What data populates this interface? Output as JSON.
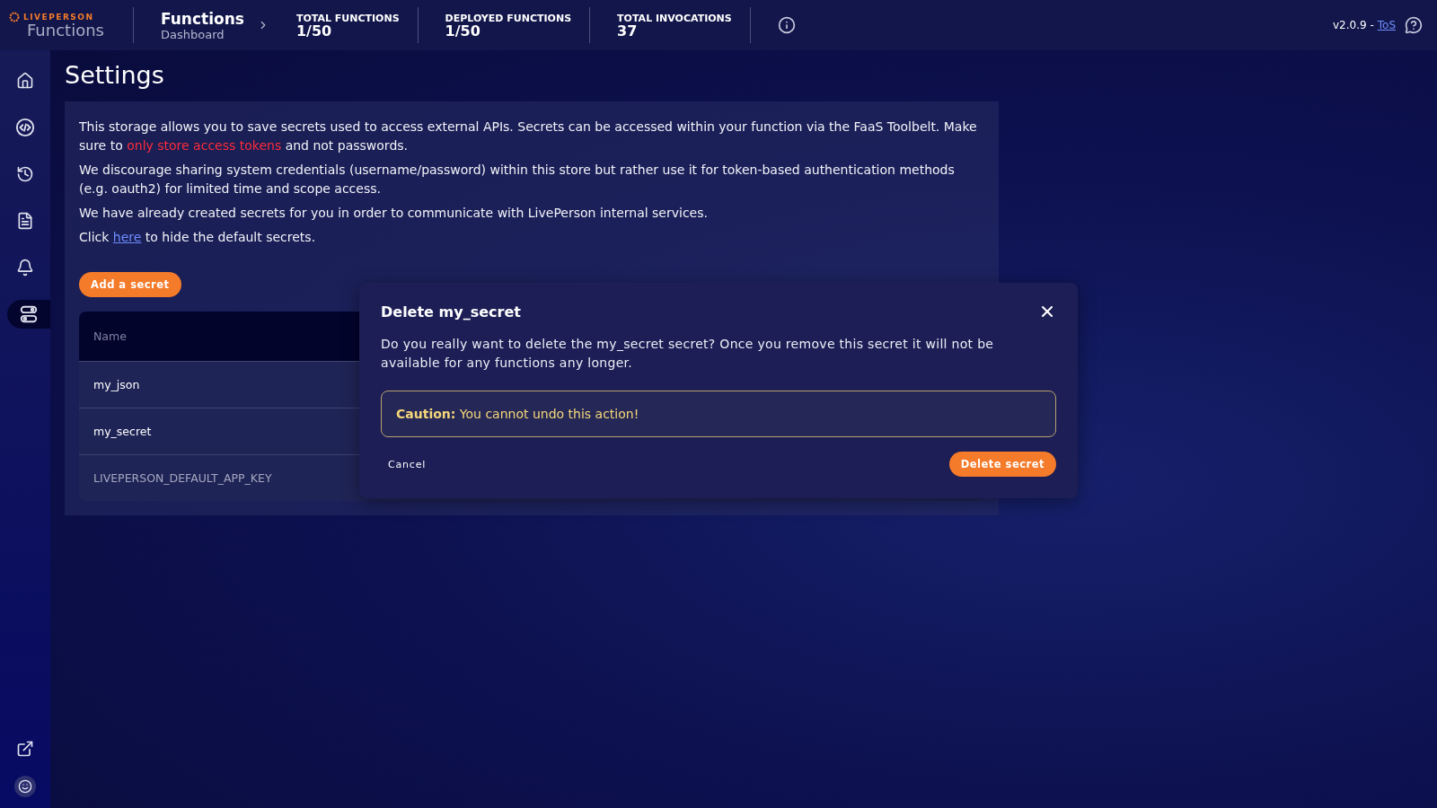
{
  "header": {
    "logo": {
      "brand": "LIVEPERSON",
      "product": "Functions"
    },
    "breadcrumb": {
      "title": "Functions",
      "subtitle": "Dashboard"
    },
    "stats": [
      {
        "label": "TOTAL FUNCTIONS",
        "value": "1/50"
      },
      {
        "label": "DEPLOYED FUNCTIONS",
        "value": "1/50"
      },
      {
        "label": "TOTAL INVOCATIONS",
        "value": "37"
      }
    ],
    "version": "v2.0.9 - ",
    "tos_link": "ToS"
  },
  "sidebar": {
    "items": [
      {
        "kind": "home",
        "selected": false
      },
      {
        "kind": "code",
        "selected": false
      },
      {
        "kind": "history",
        "selected": false
      },
      {
        "kind": "document",
        "selected": false
      },
      {
        "kind": "bell",
        "selected": false
      },
      {
        "kind": "toggles",
        "selected": true
      }
    ],
    "bottom": [
      {
        "kind": "external"
      },
      {
        "kind": "avatar"
      }
    ]
  },
  "page": {
    "title": "Settings",
    "paragraphs": [
      [
        {
          "kind": "text",
          "text": "This storage allows you to save secrets used to access external APIs. Secrets can be accessed within your function via the FaaS Toolbelt. Make sure to "
        },
        {
          "kind": "highlight",
          "text": "only store access tokens"
        },
        {
          "kind": "text",
          "text": " and not passwords."
        }
      ],
      [
        {
          "kind": "text",
          "text": "We discourage sharing system credentials (username/password) within this store but rather use it for token-based authentication methods (e.g. oauth2) for limited time and scope access."
        }
      ],
      [
        {
          "kind": "text",
          "text": "We have already created secrets for you in order to communicate with LivePerson internal services."
        }
      ],
      [
        {
          "kind": "text",
          "text": "Click "
        },
        {
          "kind": "link",
          "text": "here"
        },
        {
          "kind": "text",
          "text": " to hide the default secrets."
        }
      ]
    ],
    "add_button": "Add a secret",
    "table": {
      "columns": [
        "Name"
      ],
      "rows": [
        {
          "name": "my_json",
          "muted": false
        },
        {
          "name": "my_secret",
          "muted": false
        },
        {
          "name": "LIVEPERSON_DEFAULT_APP_KEY",
          "muted": true
        }
      ]
    }
  },
  "dialog": {
    "title": "Delete my_secret",
    "message": "Do you really want to delete the my_secret secret? Once you remove this secret it will not be available for any functions any longer.",
    "caution_label": "Caution:",
    "caution_text": "You cannot undo this action!",
    "cancel": "Cancel",
    "confirm": "Delete secret"
  }
}
